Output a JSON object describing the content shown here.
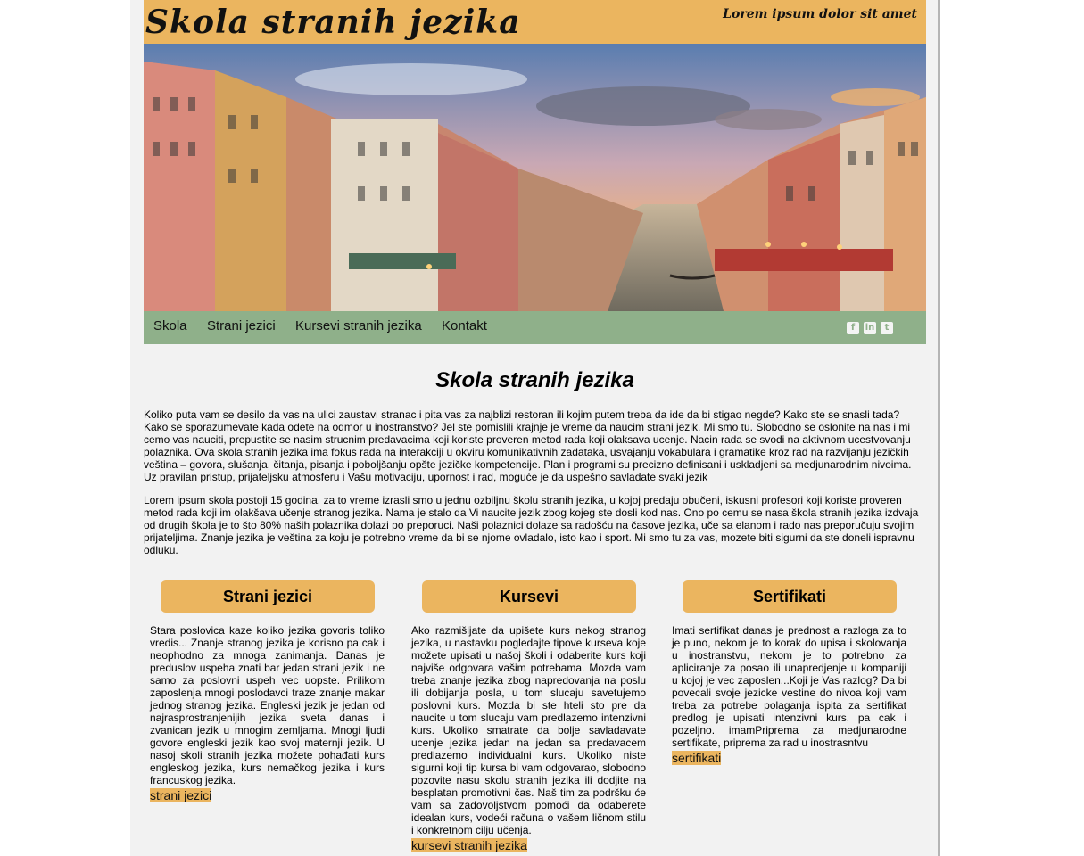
{
  "header": {
    "title": "Skola stranih jezika",
    "tagline": "Lorem ipsum dolor sit amet"
  },
  "nav": {
    "items": [
      "Skola",
      "Strani jezici",
      "Kursevi stranih jezika",
      "Kontakt"
    ],
    "social": [
      "f",
      "in",
      "t"
    ]
  },
  "colors": {
    "accent": "#ebb55f",
    "nav_bg": "#8fb08a",
    "page_bg": "#f2f2f2"
  },
  "main": {
    "heading": "Skola stranih jezika",
    "paragraphs": [
      "Koliko puta vam se desilo da vas na ulici zaustavi stranac i pita vas za najblizi restoran ili kojim putem treba da ide da bi stigao negde? Kako ste se snasli tada? Kako se sporazumevate kada odete na odmor u inostranstvo? Jel ste pomislili krajnje je vreme da naucim strani jezik. Mi smo tu. Slobodno se oslonite na nas i mi cemo vas nauciti, prepustite se nasim strucnim predavacima koji koriste proveren metod rada koji olaksava ucenje. Nacin rada se svodi na aktivnom ucestvovanju polaznika. Ova skola stranih jezika ima fokus rada na interakciji u okviru komunikativnih zadataka, usvajanju vokabulara i gramatike kroz rad na razvijanju jezičkih veština – govora, slušanja, čitanja, pisanja i poboljšanju opšte jezičke kompetencije. Plan i programi su precizno definisani i uskladjeni sa medjunarodnim nivoima. Uz pravilan pristup, prijateljsku atmosferu i Vašu motivaciju, upornost i rad, moguće je da uspešno savladate svaki jezik",
      "Lorem ipsum skola postoji 15 godina, za to vreme izrasli smo u jednu ozbiljnu školu stranih jezika, u kojoj predaju obučeni, iskusni profesori koji koriste proveren metod rada koji im olakšava učenje stranog jezika. Nama je stalo da Vi naucite jezik zbog kojeg ste dosli kod nas. Ono po cemu se nasa škola stranih jezika izdvaja od drugih škola je to što 80% naših polaznika dolazi po preporuci. Naši polaznici dolaze sa radošću na časove jezika, uče sa elanom i rado nas preporučuju svojim prijateljima. Znanje jezika je veština za koju je potrebno vreme da bi se njome ovladalo, isto kao i sport. Mi smo tu za vas, mozete biti sigurni da ste doneli ispravnu odluku."
    ]
  },
  "columns": [
    {
      "heading": "Strani jezici",
      "text": "Stara poslovica kaze koliko jezika govoris toliko vredis... Znanje stranog jezika je korisno pa cak i neophodno za mnoga zanimanja. Danas je preduslov uspeha znati bar jedan strani jezik i ne samo za poslovni uspeh vec uopste. Prilikom zaposlenja mnogi poslodavci traze znanje makar jednog stranog jezika. Engleski jezik je jedan od najrasprostranjenijih jezika sveta danas i zvanican jezik u mnogim zemljama. Mnogi ljudi govore engleski jezik kao svoj maternji jezik. U nasoj skoli stranih jezika možete pohađati kurs engleskog jezika, kurs nemačkog jezika i kurs francuskog jezika.",
      "link": "strani jezici"
    },
    {
      "heading": "Kursevi",
      "text": "Ako razmišljate da upišete kurs nekog stranog jezika, u nastavku pogledajte tipove kurseva koje možete upisati u našoj školi i odaberite kurs koji najviše odgovara vašim potrebama. Mozda vam treba znanje jezika zbog napredovanja na poslu ili dobijanja posla, u tom slucaju savetujemo poslovni kurs. Mozda bi ste hteli sto pre da naucite u tom slucaju vam predlazemo intenzivni kurs. Ukoliko smatrate da bolje savladavate ucenje jezika jedan na jedan sa predavacem predlazemo individualni kurs. Ukoliko niste sigurni koji tip kursa bi vam odgovarao, slobodno pozovite nasu skolu stranih jezika ili dodjite na besplatan promotivni čas. Naš tim za podršku će vam sa zadovoljstvom pomoći da odaberete idealan kurs, vodeći računa o vašem ličnom stilu i konkretnom cilju učenja.",
      "link": "kursevi stranih jezika"
    },
    {
      "heading": "Sertifikati",
      "text": "Imati sertifikat danas je prednost a razloga za to je puno, nekom je to korak do upisa i skolovanja u inostranstvu, nekom je to potrebno za apliciranje za posao ili unapredjenje u kompaniji u kojoj je vec zaposlen...Koji je Vas razlog? Da bi povecali svoje jezicke vestine do nivoa koji vam treba za potrebe polaganja ispita za sertifikat predlog je upisati intenzivni kurs, pa cak i pozeljno. imamPriprema za medjunarodne sertifikate, priprema za rad u inostrasntvu",
      "link": "sertifikati"
    }
  ]
}
